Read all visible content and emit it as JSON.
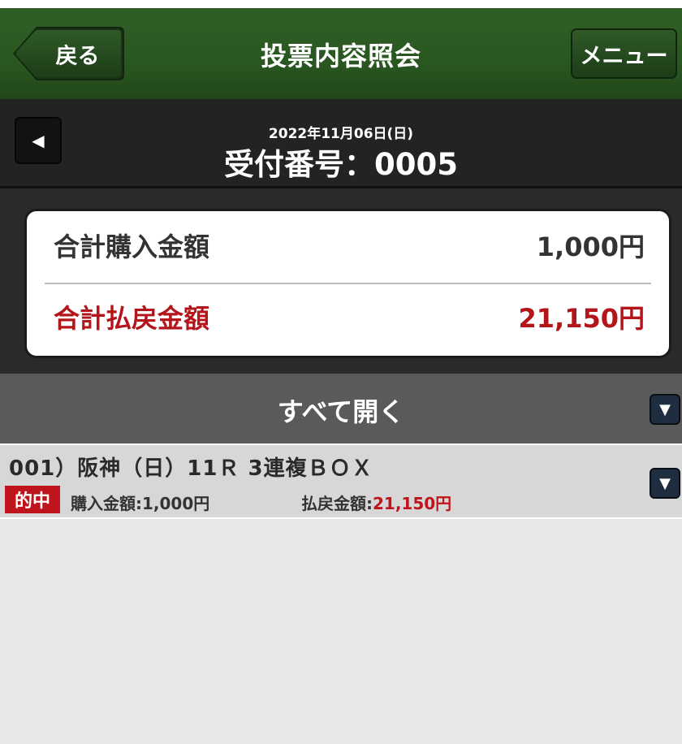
{
  "header": {
    "back_label": "戻る",
    "title": "投票内容照会",
    "menu_label": "メニュー"
  },
  "receipt": {
    "date": "2022年11月06日(日)",
    "number_label": "受付番号：0005"
  },
  "summary": {
    "purchase_label": "合計購入金額",
    "purchase_value": "1,000円",
    "payout_label": "合計払戻金額",
    "payout_value": "21,150円"
  },
  "open_all": {
    "label": "すべて開く"
  },
  "bets": [
    {
      "title": "001）阪神（日）11Ｒ 3連複ＢＯＸ",
      "badge": "的中",
      "purchase_label": "購入金額:",
      "purchase_value": "1,000円",
      "payout_label": "払戻金額:",
      "payout_value": "21,150円"
    }
  ],
  "icons": {
    "prev": "triangle-left-icon",
    "dropdown": "triangle-down-icon"
  },
  "colors": {
    "header_green": "#2a5721",
    "payout_red": "#b3151b",
    "badge_red": "#c0141c",
    "dropdown_navy": "#1e2d3f"
  }
}
